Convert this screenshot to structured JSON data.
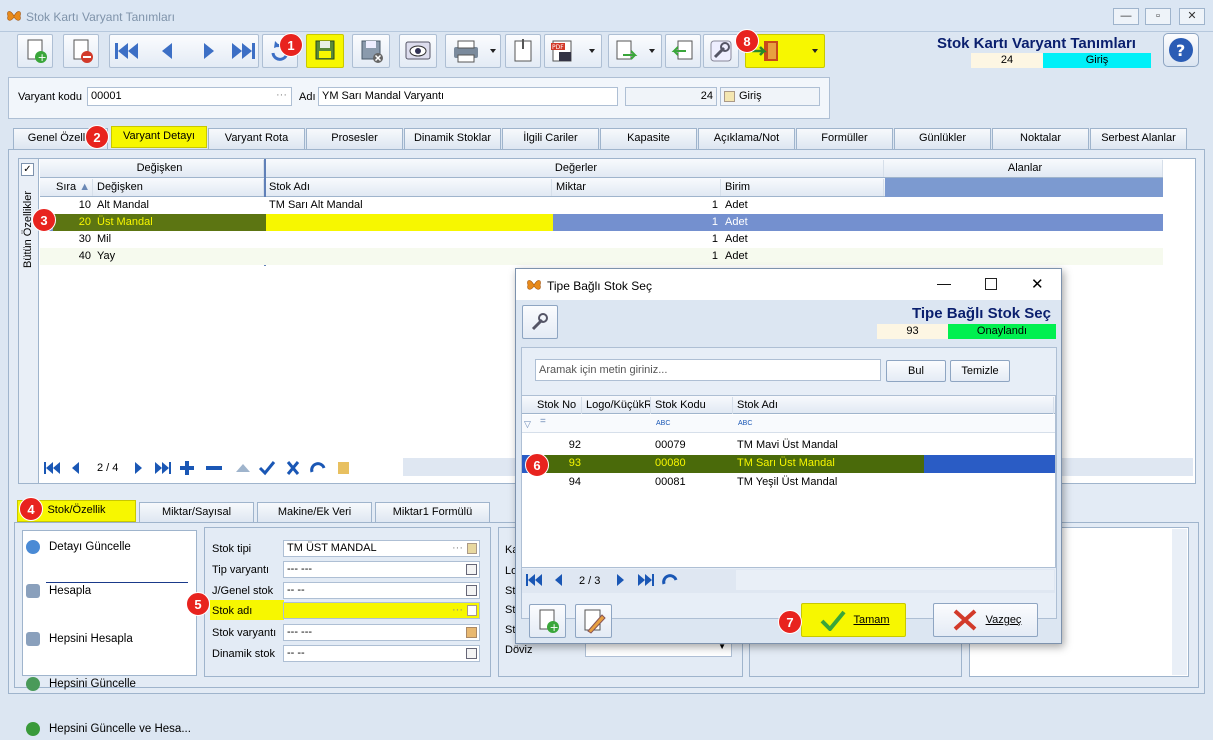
{
  "window": {
    "title": "Stok Kartı Varyant Tanımları"
  },
  "header": {
    "title": "Stok Kartı Varyant Tanımları",
    "count": "24",
    "status": "Giriş"
  },
  "form": {
    "variant_code_label": "Varyant kodu",
    "variant_code": "00001",
    "name_label": "Adı",
    "name": "YM Sarı Mandal Varyantı",
    "count": "24",
    "status": "Giriş"
  },
  "tabs": [
    "Genel Özellik",
    "Varyant Detayı",
    "Varyant Rota",
    "Prosesler",
    "Dinamik Stoklar",
    "İlgili Cariler",
    "Kapasite",
    "Açıklama/Not",
    "Formüller",
    "Günlükler",
    "Noktalar",
    "Serbest Alanlar"
  ],
  "grid": {
    "vertical_label": "Bütün Özellikler",
    "band_degisken": "Değişken",
    "band_degerler": "Değerler",
    "band_alanlar": "Alanlar",
    "columns": [
      "Sıra",
      "Değişken",
      "Stok Adı",
      "Miktar",
      "Birim"
    ],
    "rows": [
      {
        "sira": "10",
        "degisken": "Alt Mandal",
        "stok_adi": "TM Sarı Alt Mandal",
        "miktar": "1",
        "birim": "Adet"
      },
      {
        "sira": "20",
        "degisken": "Üst Mandal",
        "stok_adi": "",
        "miktar": "1",
        "birim": "Adet"
      },
      {
        "sira": "30",
        "degisken": "Mil",
        "stok_adi": "",
        "miktar": "1",
        "birim": "Adet"
      },
      {
        "sira": "40",
        "degisken": "Yay",
        "stok_adi": "",
        "miktar": "1",
        "birim": "Adet"
      }
    ],
    "pager": "2 / 4"
  },
  "bottom_tabs": [
    "Stok/Özellik",
    "Miktar/Sayısal",
    "Makine/Ek Veri",
    "Miktar1 Formülü"
  ],
  "actions": [
    "Detayı Güncelle",
    "Hesapla",
    "Hepsini Hesapla",
    "Hepsini Güncelle",
    "Hepsini Güncelle ve Hesa..."
  ],
  "stock_fields": [
    {
      "label": "Stok tipi",
      "value": "TM ÜST MANDAL"
    },
    {
      "label": "Tip varyantı",
      "value": "--- ---"
    },
    {
      "label": "J/Genel stok",
      "value": "-- --"
    },
    {
      "label": "Stok adı",
      "value": ""
    },
    {
      "label": "Stok varyantı",
      "value": "--- ---"
    },
    {
      "label": "Dinamik stok",
      "value": "-- --"
    }
  ],
  "partial_labels": [
    "Ka",
    "Lo",
    "St",
    "St",
    "St"
  ],
  "doviz_label": "Döviz",
  "dialog": {
    "title": "Tipe Bağlı Stok Seç",
    "header": "Tipe Bağlı Stok Seç",
    "count": "93",
    "status": "Onaylandı",
    "search_placeholder": "Aramak için metin giriniz...",
    "find_label": "Bul",
    "clear_label": "Temizle",
    "columns": [
      "Stok No",
      "Logo/KüçükRe",
      "Stok Kodu",
      "Stok Adı"
    ],
    "rows": [
      {
        "no": "92",
        "kod": "00079",
        "adi": "TM Mavi Üst Mandal"
      },
      {
        "no": "93",
        "kod": "00080",
        "adi": "TM Sarı Üst Mandal"
      },
      {
        "no": "94",
        "kod": "00081",
        "adi": "TM Yeşil Üst Mandal"
      }
    ],
    "pager": "2 / 3",
    "ok_label": "Tamam",
    "cancel_label": "Vazgeç"
  },
  "badges": [
    "1",
    "2",
    "3",
    "4",
    "5",
    "6",
    "7",
    "8"
  ],
  "colors": {
    "highlight": "#f7f700",
    "selected_row": "#4a6a0a",
    "accent_blue": "#0a1f6e",
    "status_cyan": "#00f0f8",
    "status_green": "#00f050",
    "badge": "#e8231e"
  }
}
